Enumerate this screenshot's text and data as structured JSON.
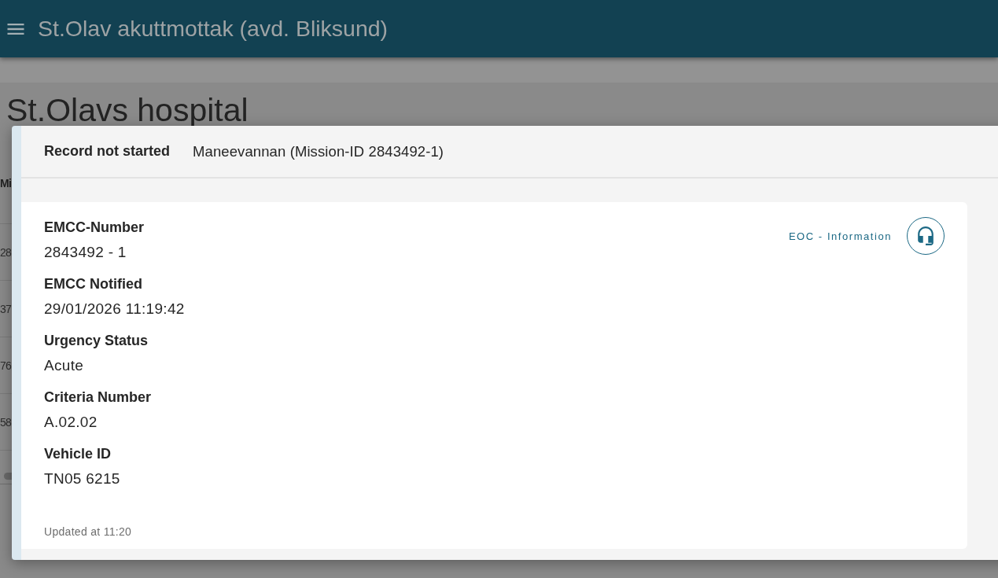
{
  "app_bar": {
    "title": "St.Olav akuttmottak (avd. Bliksund)"
  },
  "page": {
    "heading": "St.Olavs hospital",
    "table": {
      "columns": [
        "Mi"
      ],
      "rows": [
        [
          "28"
        ],
        [
          "37"
        ],
        [
          "76"
        ],
        [
          "58"
        ]
      ]
    }
  },
  "dialog": {
    "status": "Record not started",
    "subtitle": "Maneevannan (Mission-ID 2843492-1)",
    "fields": [
      {
        "label": "EMCC-Number",
        "value": "2843492 - 1"
      },
      {
        "label": "EMCC Notified",
        "value": "29/01/2026 11:19:42"
      },
      {
        "label": "Urgency Status",
        "value": "Acute"
      },
      {
        "label": "Criteria Number",
        "value": "A.02.02"
      },
      {
        "label": "Vehicle ID",
        "value": "TN05 6215"
      }
    ],
    "eoc_link": "EOC - Information",
    "updated": "Updated at 11:20"
  }
}
